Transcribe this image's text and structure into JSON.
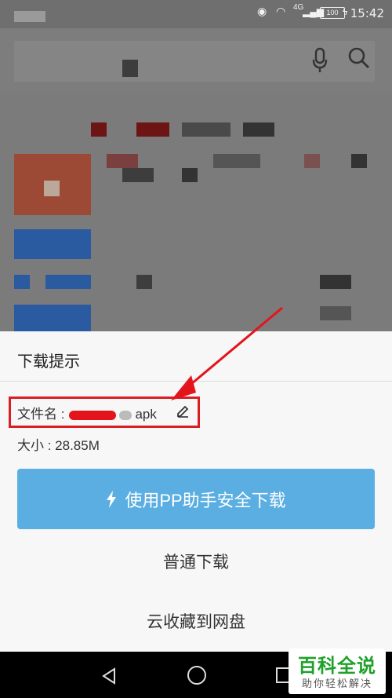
{
  "status_bar": {
    "time": "15:42",
    "battery": "100",
    "network": "4G"
  },
  "dialog": {
    "title": "下载提示",
    "filename_label": "文件名 :",
    "filename_suffix": "apk",
    "size_text": "大小 : 28.85M",
    "primary_button": "使用PP助手安全下载",
    "normal_download": "普通下载",
    "cloud_save": "云收藏到网盘"
  },
  "colors": {
    "primary": "#5aaee2",
    "highlight": "#d71f24"
  },
  "watermark": {
    "title": "百科全说",
    "subtitle": "助你轻松解决"
  }
}
